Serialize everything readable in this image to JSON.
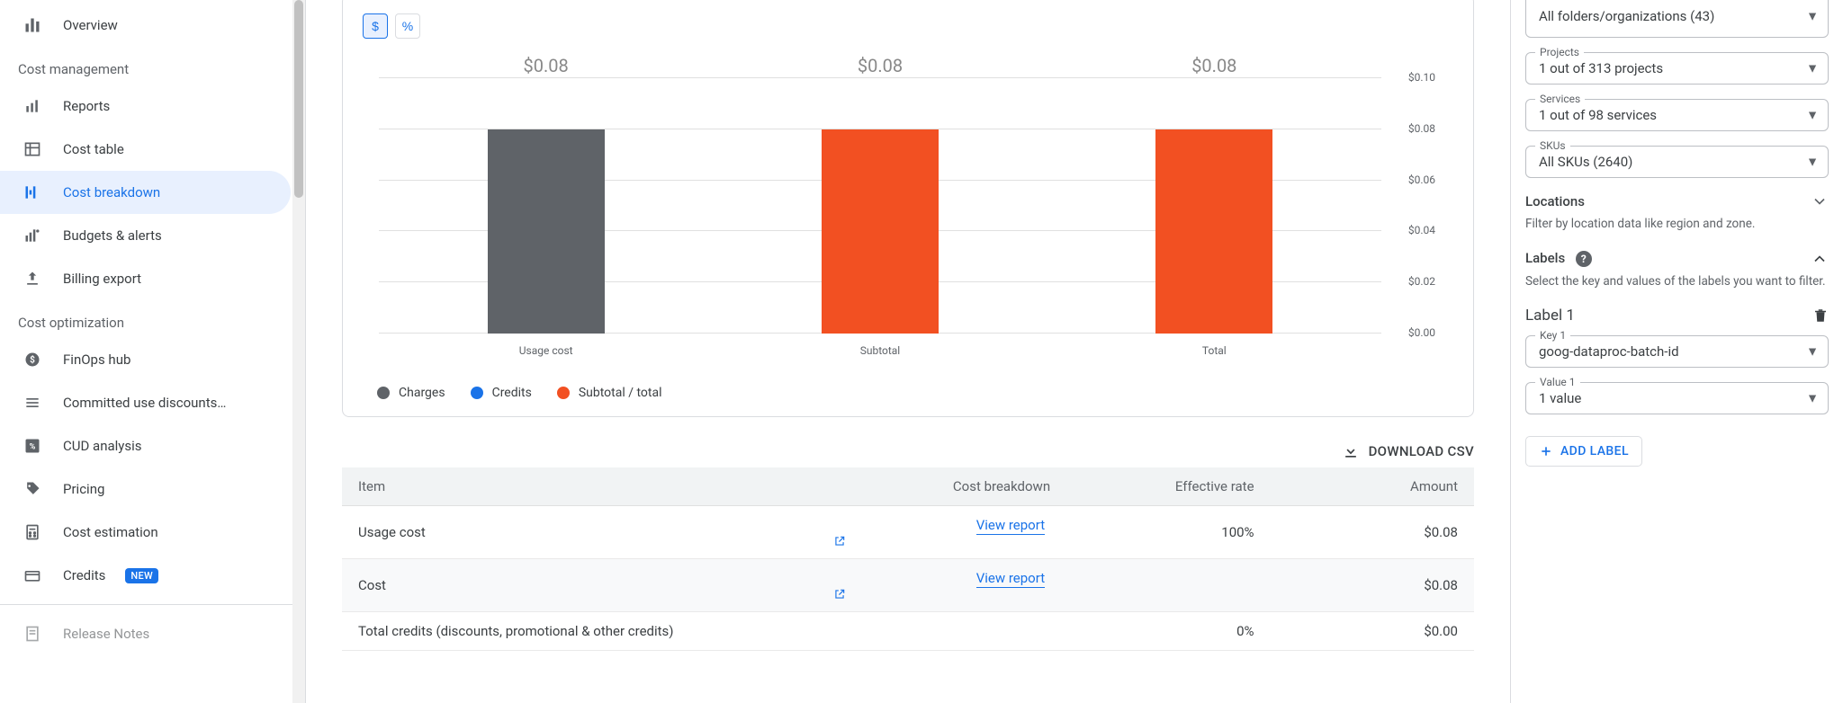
{
  "sidebar": {
    "overview": "Overview",
    "cost_management_label": "Cost management",
    "reports": "Reports",
    "cost_table": "Cost table",
    "cost_breakdown": "Cost breakdown",
    "budgets_alerts": "Budgets & alerts",
    "billing_export": "Billing export",
    "cost_optimization_label": "Cost optimization",
    "finops_hub": "FinOps hub",
    "cud": "Committed use discounts…",
    "cud_analysis": "CUD analysis",
    "pricing": "Pricing",
    "cost_estimation": "Cost estimation",
    "credits": "Credits",
    "credits_badge": "NEW",
    "release_notes": "Release Notes"
  },
  "toggle": {
    "dollar": "$",
    "percent": "%"
  },
  "chart_data": {
    "type": "bar",
    "categories": [
      "Usage cost",
      "Subtotal",
      "Total"
    ],
    "values": [
      0.08,
      0.08,
      0.08
    ],
    "value_labels": [
      "$0.08",
      "$0.08",
      "$0.08"
    ],
    "series_colors": [
      "#5f6368",
      "#f25022",
      "#f25022"
    ],
    "ylim": [
      0,
      0.1
    ],
    "yticks": [
      "$0.00",
      "$0.02",
      "$0.04",
      "$0.06",
      "$0.08",
      "$0.10"
    ],
    "legend": [
      "Charges",
      "Credits",
      "Subtotal / total"
    ],
    "legend_colors": [
      "#5f6368",
      "#1a73e8",
      "#f25022"
    ]
  },
  "download_csv": "DOWNLOAD CSV",
  "table": {
    "headers": {
      "item": "Item",
      "breakdown": "Cost breakdown",
      "rate": "Effective rate",
      "amount": "Amount"
    },
    "view_report": "View report",
    "rows": [
      {
        "item": "Usage cost",
        "has_link": true,
        "rate": "100%",
        "amount": "$0.08"
      },
      {
        "item": "Cost",
        "has_link": true,
        "rate": "",
        "amount": "$0.08"
      },
      {
        "item": "Total credits (discounts, promotional & other credits)",
        "has_link": false,
        "rate": "0%",
        "amount": "$0.00"
      }
    ]
  },
  "filters": {
    "folders": {
      "value": "All folders/organizations (43)"
    },
    "projects": {
      "label": "Projects",
      "value": "1 out of 313 projects"
    },
    "services": {
      "label": "Services",
      "value": "1 out of 98 services"
    },
    "skus": {
      "label": "SKUs",
      "value": "All SKUs (2640)"
    },
    "locations": {
      "title": "Locations",
      "hint": "Filter by location data like region and zone."
    },
    "labels": {
      "title": "Labels",
      "hint": "Select the key and values of the labels you want to filter.",
      "label1_title": "Label 1",
      "key_label": "Key 1",
      "key_value": "goog-dataproc-batch-id",
      "value_label": "Value 1",
      "value_value": "1 value",
      "add_label": "ADD LABEL"
    }
  }
}
